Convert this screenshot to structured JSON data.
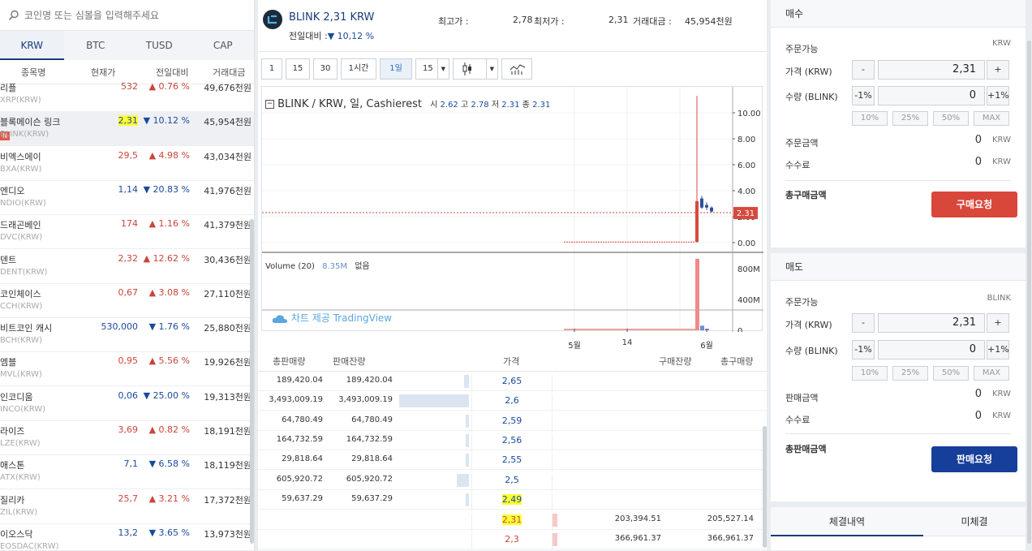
{
  "search": {
    "placeholder": "코인명 또는 심볼을 입력해주세요"
  },
  "market_tabs": [
    "KRW",
    "BTC",
    "TUSD",
    "CAP"
  ],
  "columns": [
    "종목명",
    "현재가",
    "전일대비",
    "거래대금"
  ],
  "coins": [
    {
      "name": "리플",
      "symbol": "XRP(KRW)",
      "price": "532",
      "change": "0.76 %",
      "dir": "up",
      "volume": "49,676천원"
    },
    {
      "name": "블록메이슨 링크",
      "symbol": "BLINK(KRW)",
      "price": "2,31",
      "change": "10.12 %",
      "dir": "dn",
      "volume": "45,954천원",
      "badge": "N"
    },
    {
      "name": "비엑스에이",
      "symbol": "BXA(KRW)",
      "price": "29,5",
      "change": "4.98 %",
      "dir": "up",
      "volume": "43,034천원"
    },
    {
      "name": "엔디오",
      "symbol": "NDIO(KRW)",
      "price": "1,14",
      "change": "20.83 %",
      "dir": "dn",
      "volume": "41,976천원"
    },
    {
      "name": "드래곤베인",
      "symbol": "DVC(KRW)",
      "price": "174",
      "change": "1.16 %",
      "dir": "up",
      "volume": "41,379천원"
    },
    {
      "name": "덴트",
      "symbol": "DENT(KRW)",
      "price": "2,32",
      "change": "12.62 %",
      "dir": "up",
      "volume": "30,436천원"
    },
    {
      "name": "코인체이스",
      "symbol": "CCH(KRW)",
      "price": "0,67",
      "change": "3.08 %",
      "dir": "up",
      "volume": "27,110천원"
    },
    {
      "name": "비트코인 캐시",
      "symbol": "BCH(KRW)",
      "price": "530,000",
      "change": "1.76 %",
      "dir": "dn",
      "volume": "25,880천원"
    },
    {
      "name": "엠블",
      "symbol": "MVL(KRW)",
      "price": "0,95",
      "change": "5.56 %",
      "dir": "up",
      "volume": "19,926천원"
    },
    {
      "name": "인코디움",
      "symbol": "INCO(KRW)",
      "price": "0,06",
      "change": "25.00 %",
      "dir": "dn",
      "volume": "19,313천원"
    },
    {
      "name": "라이즈",
      "symbol": "LZE(KRW)",
      "price": "3,69",
      "change": "0.82 %",
      "dir": "up",
      "volume": "18,191천원"
    },
    {
      "name": "애스톤",
      "symbol": "ATX(KRW)",
      "price": "7,1",
      "change": "6.58 %",
      "dir": "dn",
      "volume": "18,119천원"
    },
    {
      "name": "질리카",
      "symbol": "ZIL(KRW)",
      "price": "25,7",
      "change": "3.21 %",
      "dir": "up",
      "volume": "17,372천원"
    },
    {
      "name": "이오스닥",
      "symbol": "EOSDAC(KRW)",
      "price": "13,2",
      "change": "3.65 %",
      "dir": "dn",
      "volume": "13,973천원"
    }
  ],
  "header": {
    "coin": "BLINK",
    "price": "2,31 KRW",
    "prev_label": "전일대비 :",
    "prev_change": "10,12 %",
    "high_label": "최고가 :",
    "high": "2,78",
    "low_label": "최저가 :",
    "low": "2,31",
    "volume_label": "거래대금 :",
    "volume": "45,954천원"
  },
  "toolbar": [
    "1",
    "15",
    "30",
    "1시간",
    "1일",
    "15"
  ],
  "chart_data": {
    "type": "candlestick",
    "title": "BLINK / KRW, 일, Cashierest",
    "ohlc_label": {
      "o": "시",
      "o_val": "2.62",
      "h": "고",
      "h_val": "2.78",
      "l": "저",
      "l_val": "2.31",
      "c": "종",
      "c_val": "2.31"
    },
    "yticks": [
      "10.00",
      "8.00",
      "6.00",
      "4.00",
      "2.00",
      "0.00"
    ],
    "ylim": [
      0,
      11
    ],
    "last_price_label": "2.31",
    "last_price": 2.31,
    "candles": [
      {
        "o": 0.05,
        "h": 11.3,
        "l": 0.0,
        "c": 3.2,
        "color": "red"
      },
      {
        "o": 3.4,
        "h": 3.6,
        "l": 2.6,
        "c": 2.7,
        "color": "blue"
      },
      {
        "o": 2.9,
        "h": 3.1,
        "l": 2.5,
        "c": 2.7,
        "color": "blue"
      },
      {
        "o": 2.7,
        "h": 2.8,
        "l": 2.31,
        "c": 2.4,
        "color": "blue"
      }
    ],
    "volume_label": "Volume (20)",
    "volume_value": "8.35M",
    "volume_extra": "없음",
    "vticks": [
      "800M",
      "400M",
      "0"
    ],
    "vlim": [
      0,
      950
    ],
    "volumes": [
      {
        "v": 930,
        "color": "red"
      },
      {
        "v": 60,
        "color": "blue"
      },
      {
        "v": 20,
        "color": "blue"
      }
    ],
    "xticks": [
      "5월",
      "14",
      "6월"
    ],
    "watermark": "차트 제공 TradingView"
  },
  "orderbook": {
    "headers": [
      "총판매량",
      "판매잔량",
      "가격",
      "구매잔량",
      "총구매량"
    ],
    "asks": [
      {
        "total": "189,420.04",
        "remain": "189,420.04",
        "price": "2,65",
        "bar": 0.07
      },
      {
        "total": "3,493,009.19",
        "remain": "3,493,009.19",
        "price": "2,6",
        "bar": 1.0
      },
      {
        "total": "64,780.49",
        "remain": "64,780.49",
        "price": "2,59",
        "bar": 0.03
      },
      {
        "total": "164,732.59",
        "remain": "164,732.59",
        "price": "2,56",
        "bar": 0.05
      },
      {
        "total": "29,818.64",
        "remain": "29,818.64",
        "price": "2,55",
        "bar": 0.02
      },
      {
        "total": "605,920.72",
        "remain": "605,920.72",
        "price": "2,5",
        "bar": 0.17
      },
      {
        "total": "59,637.29",
        "remain": "59,637.29",
        "price": "2,49",
        "bar": 0.02,
        "highlight": true
      }
    ],
    "bids": [
      {
        "price": "2,31",
        "remain": "203,394.51",
        "total": "205,527.14",
        "highlight": true
      },
      {
        "price": "2,3",
        "remain": "366,961.37",
        "total": "366,961.37"
      }
    ]
  },
  "buy": {
    "title": "매수",
    "avail_label": "주문가능",
    "avail_unit": "KRW",
    "price_label": "가격 (KRW)",
    "price": "2,31",
    "qty_label": "수량 (BLINK)",
    "qty": "0",
    "minus": "-",
    "plus": "+",
    "minus_pct": "-1%",
    "plus_pct": "+1%",
    "pcts": [
      "10%",
      "25%",
      "50%",
      "MAX"
    ],
    "amount_label": "주문금액",
    "amount": "0",
    "amount_unit": "KRW",
    "fee_label": "수수료",
    "fee": "0",
    "fee_unit": "KRW",
    "total_label": "총구매금액",
    "button": "구매요청"
  },
  "sell": {
    "title": "매도",
    "avail_label": "주문가능",
    "avail_unit": "BLINK",
    "price_label": "가격 (KRW)",
    "price": "2,31",
    "qty_label": "수량 (BLINK)",
    "qty": "0",
    "minus": "-",
    "plus": "+",
    "minus_pct": "-1%",
    "plus_pct": "+1%",
    "pcts": [
      "10%",
      "25%",
      "50%",
      "MAX"
    ],
    "amount_label": "판매금액",
    "amount": "0",
    "amount_unit": "KRW",
    "fee_label": "수수료",
    "fee": "0",
    "fee_unit": "KRW",
    "total_label": "총판매금액",
    "button": "판매요청"
  },
  "history_tabs": [
    "체결내역",
    "미체결"
  ],
  "colors": {
    "up": "#c8463a",
    "down": "#1a4a9c",
    "buy_button": "#d9473b",
    "sell_button": "#163f9b",
    "highlight": "#ffff33"
  }
}
